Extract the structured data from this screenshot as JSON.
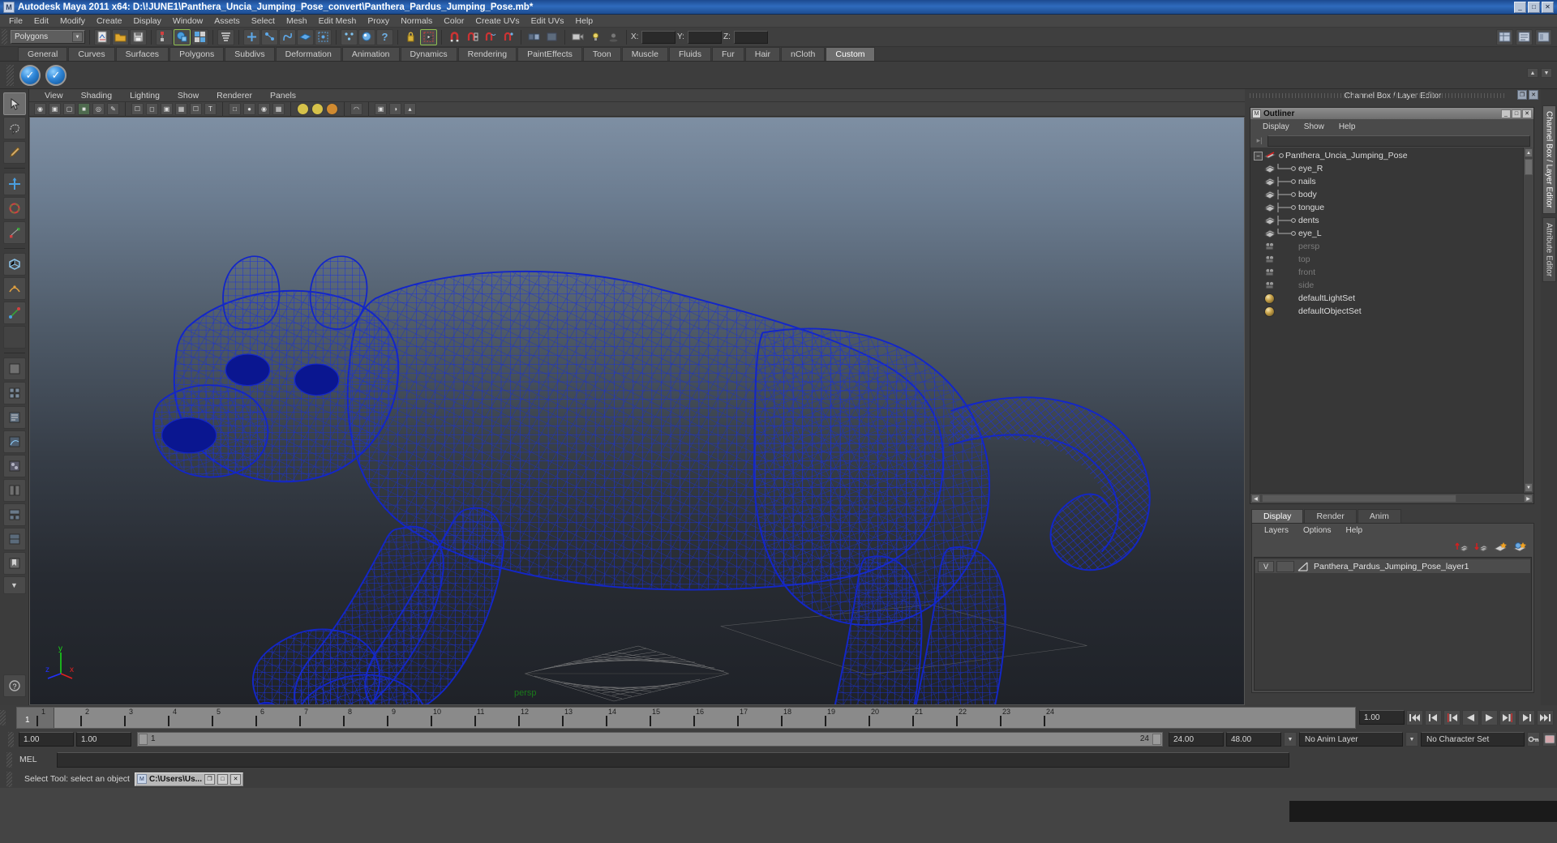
{
  "titlebar": {
    "title": "Autodesk Maya 2011 x64: D:\\!JUNE1\\Panthera_Uncia_Jumping_Pose_convert\\Panthera_Pardus_Jumping_Pose.mb*",
    "icon": "maya-logo-icon",
    "minimize": "_",
    "maximize": "□",
    "close": "✕"
  },
  "menubar": {
    "items": [
      "File",
      "Edit",
      "Modify",
      "Create",
      "Display",
      "Window",
      "Assets",
      "Select",
      "Mesh",
      "Edit Mesh",
      "Proxy",
      "Normals",
      "Color",
      "Create UVs",
      "Edit UVs",
      "Help"
    ]
  },
  "statusline": {
    "mode_menu": "Polygons",
    "x_label": "X:",
    "y_label": "Y:",
    "z_label": "Z:",
    "x_value": "",
    "y_value": "",
    "z_value": ""
  },
  "shelf": {
    "tabs": [
      "General",
      "Curves",
      "Surfaces",
      "Polygons",
      "Subdivs",
      "Deformation",
      "Animation",
      "Dynamics",
      "Rendering",
      "PaintEffects",
      "Toon",
      "Muscle",
      "Fluids",
      "Fur",
      "Hair",
      "nCloth",
      "Custom"
    ],
    "active_tab": "Custom",
    "buttons": [
      "shelf-item-1",
      "shelf-item-2"
    ]
  },
  "viewport": {
    "menus": [
      "View",
      "Shading",
      "Lighting",
      "Show",
      "Renderer",
      "Panels"
    ],
    "camera_label": "persp",
    "axis": {
      "x": "x",
      "y": "y",
      "z": "z"
    },
    "wireframe_color": "#1a2fd0",
    "background_top": "#7e8fa3",
    "background_bottom": "#1f2228"
  },
  "channelbox": {
    "header_title": "Channel Box / Layer Editor",
    "restore": "❐",
    "close": "✕"
  },
  "outliner": {
    "window_title": "Outliner",
    "window_buttons": {
      "minimize": "_",
      "maximize": "□",
      "close": "✕"
    },
    "menus": [
      "Display",
      "Show",
      "Help"
    ],
    "search_value": "",
    "items": [
      {
        "label": "Panthera_Uncia_Jumping_Pose",
        "type": "group",
        "depth": 0,
        "dim": false,
        "expanded": true
      },
      {
        "label": "eye_R",
        "type": "mesh",
        "depth": 1,
        "dim": false
      },
      {
        "label": "nails",
        "type": "mesh",
        "depth": 1,
        "dim": false
      },
      {
        "label": "body",
        "type": "mesh",
        "depth": 1,
        "dim": false
      },
      {
        "label": "tongue",
        "type": "mesh",
        "depth": 1,
        "dim": false
      },
      {
        "label": "dents",
        "type": "mesh",
        "depth": 1,
        "dim": false
      },
      {
        "label": "eye_L",
        "type": "mesh",
        "depth": 1,
        "dim": false
      },
      {
        "label": "persp",
        "type": "camera",
        "depth": 1,
        "dim": true
      },
      {
        "label": "top",
        "type": "camera",
        "depth": 1,
        "dim": true
      },
      {
        "label": "front",
        "type": "camera",
        "depth": 1,
        "dim": true
      },
      {
        "label": "side",
        "type": "camera",
        "depth": 1,
        "dim": true
      },
      {
        "label": "defaultLightSet",
        "type": "set",
        "depth": 1,
        "dim": false
      },
      {
        "label": "defaultObjectSet",
        "type": "set",
        "depth": 1,
        "dim": false
      }
    ]
  },
  "editor_tabs": {
    "items": [
      "Display",
      "Render",
      "Anim"
    ],
    "active": "Display"
  },
  "layer_editor": {
    "menus": [
      "Layers",
      "Options",
      "Help"
    ],
    "tool_icons": [
      "new-layer-up-icon",
      "new-layer-down-icon",
      "layer-shade-icon",
      "layer-render-icon"
    ],
    "layers": [
      {
        "visibility": "V",
        "state": "",
        "name": "Panthera_Pardus_Jumping_Pose_layer1"
      }
    ]
  },
  "vertical_tabs": {
    "items": [
      "Channel Box / Layer Editor",
      "Attribute Editor"
    ],
    "active": "Channel Box / Layer Editor"
  },
  "timeslider": {
    "frames": [
      "1",
      "2",
      "3",
      "4",
      "5",
      "6",
      "7",
      "8",
      "9",
      "10",
      "11",
      "12",
      "13",
      "14",
      "15",
      "16",
      "17",
      "18",
      "19",
      "20",
      "21",
      "22",
      "23",
      "24"
    ],
    "current_frame": "1",
    "current_time_field": "1.00",
    "playback_buttons": [
      "go-to-start-icon",
      "step-back-keyframe-icon",
      "step-back-frame-icon",
      "play-backwards-icon",
      "play-forwards-icon",
      "step-forward-frame-icon",
      "step-forward-keyframe-icon",
      "go-to-end-icon"
    ]
  },
  "rangeslider": {
    "anim_start": "1.00",
    "range_start": "1.00",
    "bar_start_label": "1",
    "bar_end_label": "24",
    "range_end": "24.00",
    "anim_end": "48.00",
    "anim_layer": "No Anim Layer",
    "character_set": "No Character Set",
    "key_icon": "auto-keyframe-icon",
    "prefs_icon": "animation-preferences-icon"
  },
  "command_line": {
    "language_label": "MEL",
    "input_value": ""
  },
  "statusbar": {
    "help_text": "Select Tool: select an object",
    "taskbar_item": "C:\\Users\\Us...",
    "taskbar_buttons": {
      "restore": "❐",
      "maximize": "□",
      "close": "✕"
    }
  },
  "toolbox": {
    "items": [
      "select-tool",
      "lasso-select-tool",
      "paint-select-tool",
      "move-tool",
      "rotate-tool",
      "scale-tool",
      "universal-manipulator-tool",
      "soft-modification-tool",
      "show-manipulator-tool",
      "last-tool-used",
      "layout-single-pane",
      "layout-four-pane",
      "layout-persp-outliner",
      "layout-persp-graph",
      "layout-persp-hypershade",
      "layout-two-pane",
      "layout-three-pane",
      "layout-outliner-persp",
      "bookmark-layout",
      "help-tool"
    ]
  }
}
